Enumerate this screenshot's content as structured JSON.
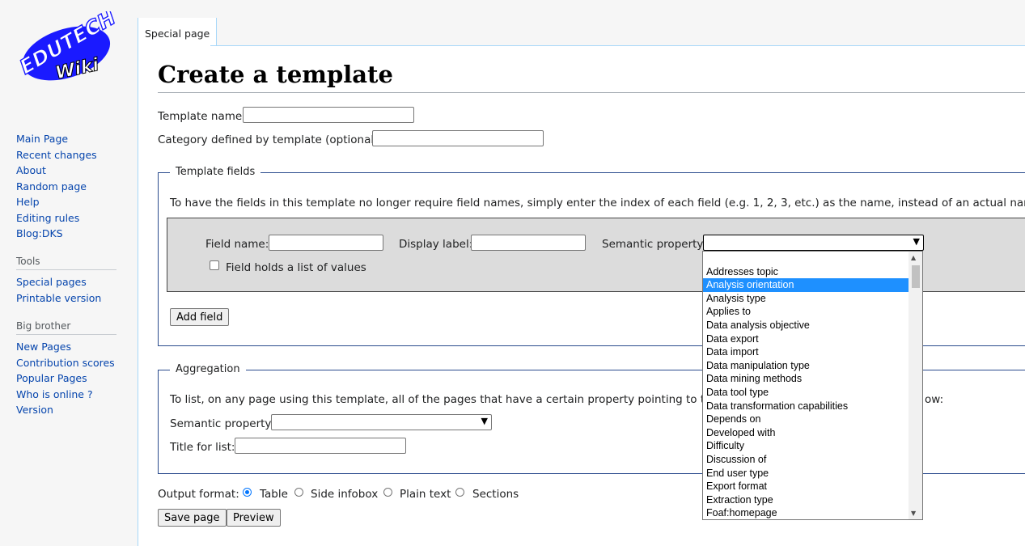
{
  "logo": {
    "line1": "EDUTECH",
    "line2": "Wiki"
  },
  "tab": {
    "label": "Special page"
  },
  "nav": {
    "main": [
      "Main Page",
      "Recent changes",
      "About",
      "Random page",
      "Help",
      "Editing rules",
      "Blog:DKS"
    ],
    "tools_heading": "Tools",
    "tools": [
      "Special pages",
      "Printable version"
    ],
    "bigbrother_heading": "Big brother",
    "bigbrother": [
      "New Pages",
      "Contribution scores",
      "Popular Pages",
      "Who is online ?",
      "Version"
    ]
  },
  "page": {
    "title": "Create a template",
    "template_name_label": "Template name:",
    "template_name_value": "",
    "category_label": "Category defined by template (optional):",
    "category_value": ""
  },
  "fields": {
    "legend": "Template fields",
    "instructions": "To have the fields in this template no longer require field names, simply enter the index of each field (e.g. 1, 2, 3, etc.) as the name, instead of an actual name.",
    "field_name_label": "Field name:",
    "display_label_label": "Display label:",
    "semantic_property_label": "Semantic property:",
    "list_checkbox_label": "Field holds a list of values",
    "add_field_button": "Add field"
  },
  "dropdown": {
    "selected_value": "",
    "options": [
      "",
      "Addresses topic",
      "Analysis orientation",
      "Analysis type",
      "Applies to",
      "Data analysis objective",
      "Data export",
      "Data import",
      "Data manipulation type",
      "Data mining methods",
      "Data tool type",
      "Data transformation capabilities",
      "Depends on",
      "Developed with",
      "Difficulty",
      "Discussion of",
      "End user type",
      "Export format",
      "Extraction type",
      "Foaf:homepage"
    ],
    "highlighted": "Analysis orientation"
  },
  "aggregation": {
    "legend": "Aggregation",
    "instructions_left": "To list, on any page using this template, all of the pages that have a certain property pointing to that p",
    "instructions_right": "ow:",
    "semantic_property_label": "Semantic property:",
    "title_label": "Title for list:"
  },
  "output": {
    "label": "Output format:",
    "options": [
      "Table",
      "Side infobox",
      "Plain text",
      "Sections"
    ],
    "selected": "Table"
  },
  "buttons": {
    "save": "Save page",
    "preview": "Preview"
  },
  "colors": {
    "link": "#0645ad",
    "fieldset_border": "#2a4b8d",
    "selection": "#1e90ff",
    "logo_blue": "#1a1aff"
  }
}
